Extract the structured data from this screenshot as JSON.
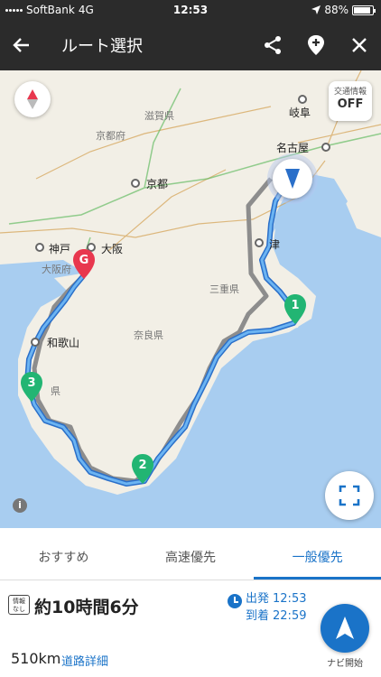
{
  "status_bar": {
    "carrier": "SoftBank",
    "network": "4G",
    "time": "12:53",
    "battery": "88%",
    "battery_level": 0.88
  },
  "header": {
    "title": "ルート選択",
    "icons": [
      "back-arrow-icon",
      "share-icon",
      "add-place-icon",
      "close-icon"
    ]
  },
  "map": {
    "traffic_button": {
      "label": "交通情報",
      "state": "OFF"
    },
    "labels": {
      "gifu": "岐阜",
      "nagoya": "名古屋",
      "shiga": "滋賀県",
      "kyotofu": "京都府",
      "kyoto": "京都",
      "kobe": "神戸",
      "osaka": "大阪",
      "osakafu": "大阪府",
      "tsu": "津",
      "mie": "三重県",
      "wakayama": "和歌山",
      "nara": "奈良県",
      "ken": "県"
    },
    "markers": {
      "goal": "G",
      "route1": "1",
      "route2": "2",
      "route3": "3"
    },
    "colors": {
      "route_blue": "#3a8fe0",
      "route_gray": "#8d8d8d",
      "goal_red": "#e8374e",
      "marker_green": "#22b573",
      "water": "#a8cdf0",
      "land": "#f2efe6"
    }
  },
  "tabs": [
    {
      "label": "おすすめ",
      "active": false
    },
    {
      "label": "高速優先",
      "active": false
    },
    {
      "label": "一般優先",
      "active": true
    }
  ],
  "summary": {
    "badge_line1": "情報",
    "badge_line2": "なし",
    "duration": "約10時間6分",
    "depart_label": "出発",
    "depart_time": "12:53",
    "arrive_label": "到着",
    "arrive_time": "22:59",
    "distance": "510km",
    "detail_link": "道路詳細",
    "nav_start_label": "ナビ開始"
  }
}
